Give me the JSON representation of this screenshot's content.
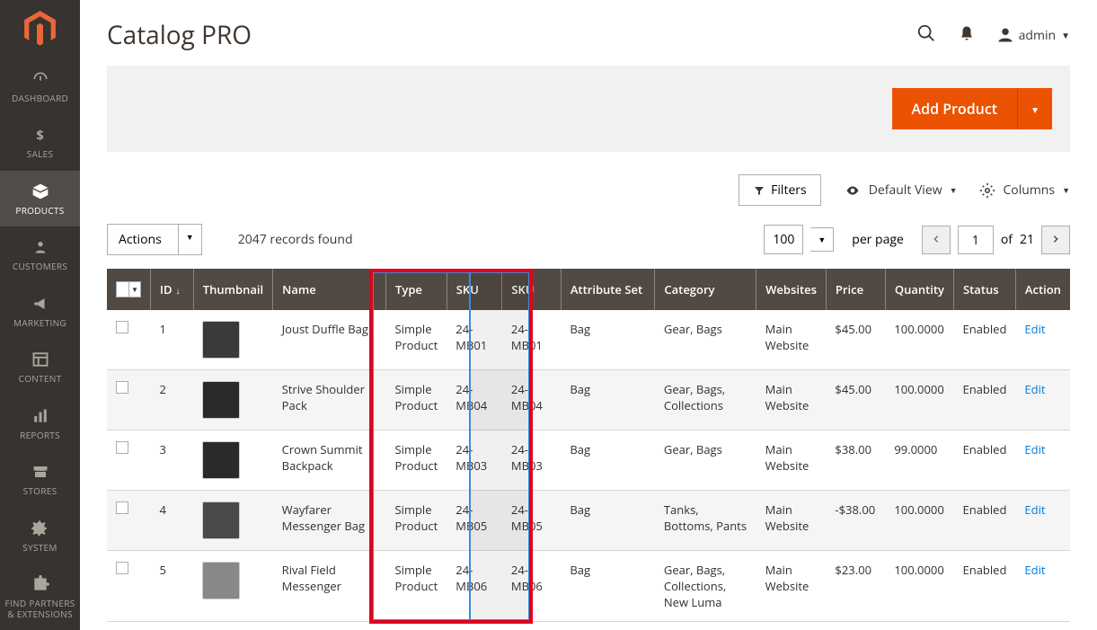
{
  "sidebar": {
    "items": [
      {
        "label": "DASHBOARD"
      },
      {
        "label": "SALES"
      },
      {
        "label": "PRODUCTS"
      },
      {
        "label": "CUSTOMERS"
      },
      {
        "label": "MARKETING"
      },
      {
        "label": "CONTENT"
      },
      {
        "label": "REPORTS"
      },
      {
        "label": "STORES"
      },
      {
        "label": "SYSTEM"
      },
      {
        "label": "FIND PARTNERS & EXTENSIONS"
      }
    ]
  },
  "header": {
    "title": "Catalog PRO",
    "user_label": "admin"
  },
  "action_bar": {
    "add_product_label": "Add Product"
  },
  "toolbar": {
    "filters_label": "Filters",
    "default_view_label": "Default View",
    "columns_label": "Columns"
  },
  "pager": {
    "actions_label": "Actions",
    "records_found": "2047 records found",
    "per_page_value": "100",
    "per_page_label": "per page",
    "current_page": "1",
    "of_label": "of",
    "total_pages": "21"
  },
  "grid": {
    "headers": {
      "checkbox": "",
      "id": "ID",
      "thumbnail": "Thumbnail",
      "name": "Name",
      "type": "Type",
      "sku": "SKU",
      "sku_dup": "SKU",
      "attribute_set": "Attribute Set",
      "category": "Category",
      "websites": "Websites",
      "price": "Price",
      "quantity": "Quantity",
      "status": "Status",
      "action": "Action"
    },
    "edit_label": "Edit",
    "rows": [
      {
        "id": "1",
        "name": "Joust Duffle Bag",
        "type": "Simple Product",
        "sku": "24-MB01",
        "sku_dup": "24-MB01",
        "attr": "Bag",
        "category": "Gear, Bags",
        "websites": "Main Website",
        "price": "$45.00",
        "qty": "100.0000",
        "status": "Enabled"
      },
      {
        "id": "2",
        "name": "Strive Shoulder Pack",
        "type": "Simple Product",
        "sku": "24-MB04",
        "sku_dup": "24-MB04",
        "attr": "Bag",
        "category": "Gear, Bags, Collections",
        "websites": "Main Website",
        "price": "$45.00",
        "qty": "100.0000",
        "status": "Enabled"
      },
      {
        "id": "3",
        "name": "Crown Summit Backpack",
        "type": "Simple Product",
        "sku": "24-MB03",
        "sku_dup": "24-MB03",
        "attr": "Bag",
        "category": "Gear, Bags",
        "websites": "Main Website",
        "price": "$38.00",
        "qty": "99.0000",
        "status": "Enabled"
      },
      {
        "id": "4",
        "name": "Wayfarer Messenger Bag",
        "type": "Simple Product",
        "sku": "24-MB05",
        "sku_dup": "24-MB05",
        "attr": "Bag",
        "category": "Tanks, Bottoms, Pants",
        "websites": "Main Website",
        "price": "-$38.00",
        "qty": "100.0000",
        "status": "Enabled"
      },
      {
        "id": "5",
        "name": "Rival Field Messenger",
        "type": "Simple Product",
        "sku": "24-MB06",
        "sku_dup": "24-MB06",
        "attr": "Bag",
        "category": "Gear, Bags, Collections, New Luma",
        "websites": "Main Website",
        "price": "$23.00",
        "qty": "100.0000",
        "status": "Enabled"
      }
    ]
  }
}
